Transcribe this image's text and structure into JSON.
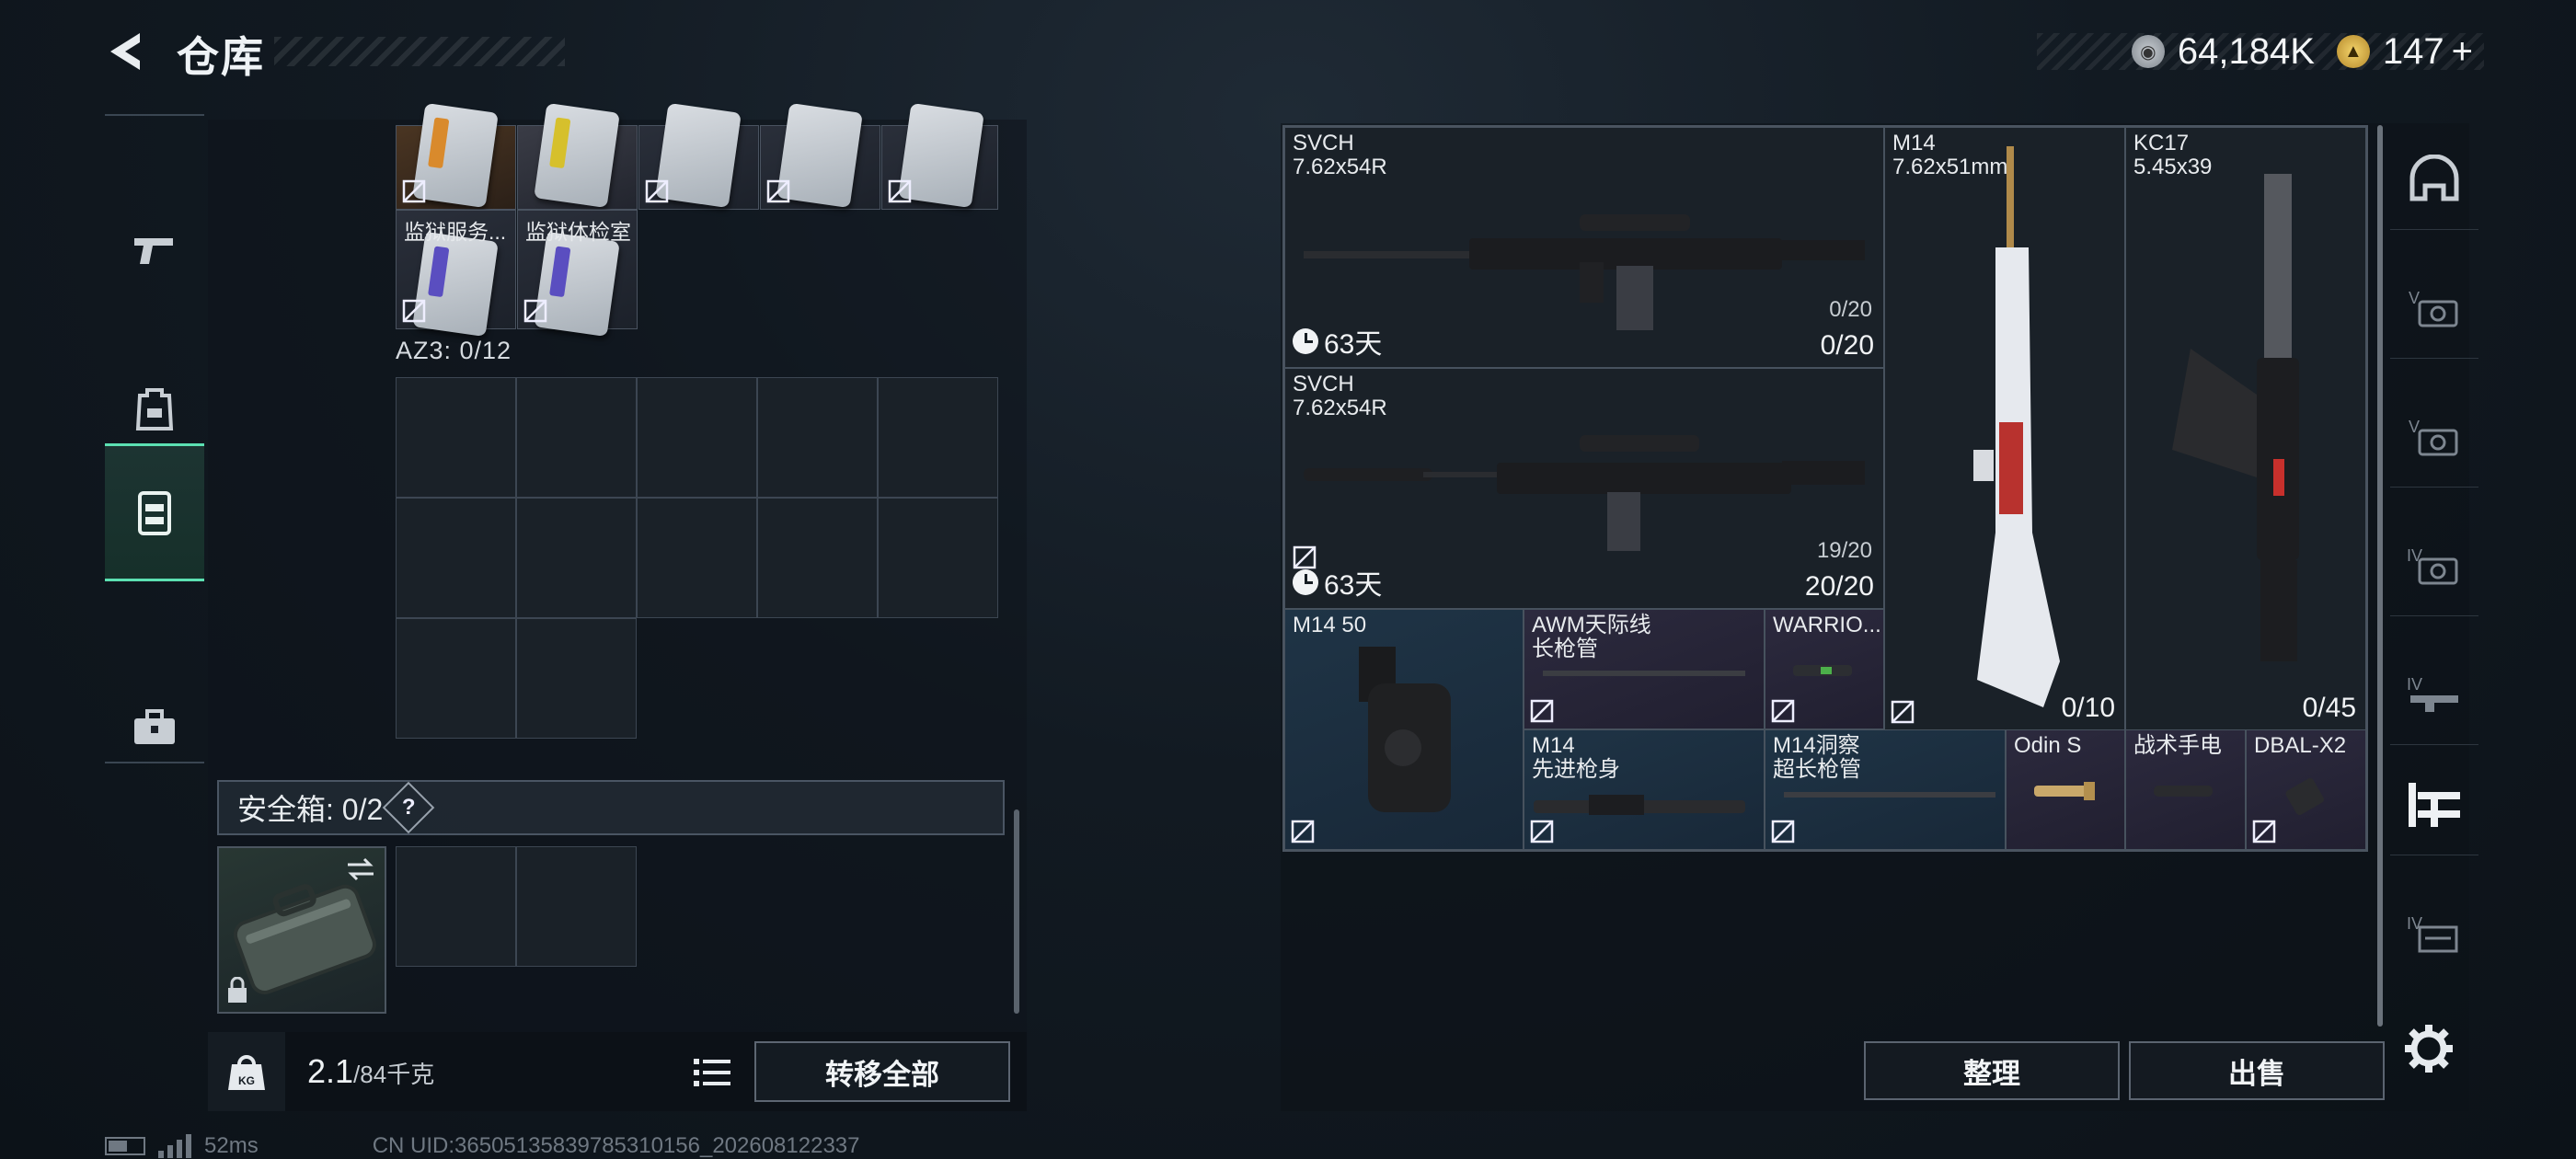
{
  "header": {
    "title": "仓库",
    "currency_primary": "64,184K",
    "currency_secondary": "147",
    "currency_plus": "+"
  },
  "left_nav": {
    "items": [
      {
        "name": "weapons",
        "icon": "pistol-icon"
      },
      {
        "name": "armor",
        "icon": "backpack-icon"
      },
      {
        "name": "containers",
        "icon": "chest-rig-icon",
        "active": true
      },
      {
        "name": "cases",
        "icon": "toolbox-icon"
      }
    ]
  },
  "inventory": {
    "cards": [
      {
        "label": ""
      },
      {
        "label": ""
      },
      {
        "label": ""
      },
      {
        "label": ""
      },
      {
        "label": ""
      },
      {
        "label": "监狱服务..."
      },
      {
        "label": "监狱体检室"
      }
    ],
    "az3_label": "AZ3: 0/12",
    "safe_label": "安全箱: 0/2",
    "help_symbol": "?",
    "weight_current": "2.1",
    "weight_max": "/84千克",
    "transfer_all": "转移全部"
  },
  "stash": {
    "slots": [
      {
        "name": "SVCH",
        "caliber": "7.62x54R",
        "ammo_small": "0/20",
        "ammo": "0/20",
        "time": "63天"
      },
      {
        "name": "SVCH",
        "caliber": "7.62x54R",
        "ammo_small": "19/20",
        "ammo": "20/20",
        "time": "63天"
      },
      {
        "name": "M14",
        "caliber": "7.62x51mm",
        "ammo": "0/10"
      },
      {
        "name": "KC17",
        "caliber": "5.45x39",
        "ammo": "0/45"
      },
      {
        "name": "M14 50",
        "caliber": ""
      },
      {
        "name": "AWM天际线",
        "caliber": "长枪管"
      },
      {
        "name": "WARRIO...",
        "caliber": ""
      },
      {
        "name": "M14",
        "caliber": "先进枪身"
      },
      {
        "name": "M14洞察",
        "caliber": "超长枪管"
      },
      {
        "name": "Odin S",
        "caliber": ""
      },
      {
        "name": "战术手电",
        "caliber": ""
      },
      {
        "name": "DBAL-X2",
        "caliber": ""
      }
    ],
    "sort_label": "整理",
    "sell_label": "出售"
  },
  "footer": {
    "ping": "52ms",
    "uid": "CN UID:36505135839785310156_202608122337"
  },
  "colors": {
    "accent": "#5ce0b2",
    "blue_rarity": "#1f3446",
    "purple_rarity": "#2c2a3e"
  }
}
